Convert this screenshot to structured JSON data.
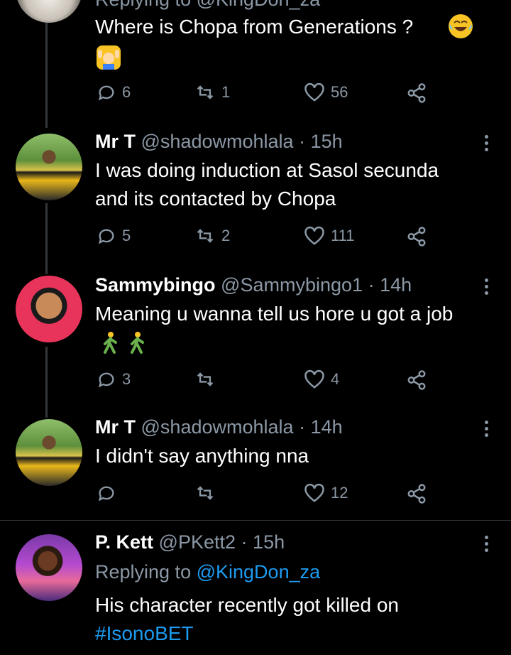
{
  "tweets": [
    {
      "reply_partial": "Replying to @KingDon_za",
      "text": "Where is Chopa from Generations ?",
      "emoji_semantic": [
        "laughing-crying-emoji",
        "person-raising-hands-emoji"
      ],
      "replies": "6",
      "retweets": "1",
      "likes": "56"
    },
    {
      "name": "Mr T",
      "handle": "@shadowmohlala",
      "time": "15h",
      "lines": [
        "I was doing induction at Sasol secunda",
        "and its contacted by Chopa"
      ],
      "replies": "5",
      "retweets": "2",
      "likes": "111"
    },
    {
      "name": "Sammybingo",
      "handle": "@Sammybingo1",
      "time": "14h",
      "text": "Meaning u wanna tell us hore u got a job",
      "emoji_semantic": [
        "person-walking-emoji",
        "person-walking-emoji"
      ],
      "replies": "3",
      "retweets": "",
      "likes": "4"
    },
    {
      "name": "Mr T",
      "handle": "@shadowmohlala",
      "time": "14h",
      "text": "I didn't say anything nna",
      "replies": "",
      "retweets": "",
      "likes": "12"
    },
    {
      "name": "P. Kett",
      "handle": "@PKett2",
      "time": "15h",
      "reply_prefix": "Replying to",
      "reply_handle": "@KingDon_za",
      "text": "His character recently got killed on",
      "hashtag": "#IsonoBET"
    }
  ],
  "separator": "·",
  "colors": {
    "background": "#000000",
    "secondary": "#8b98a5",
    "link": "#1d9bf0",
    "thread_line": "#333639"
  }
}
